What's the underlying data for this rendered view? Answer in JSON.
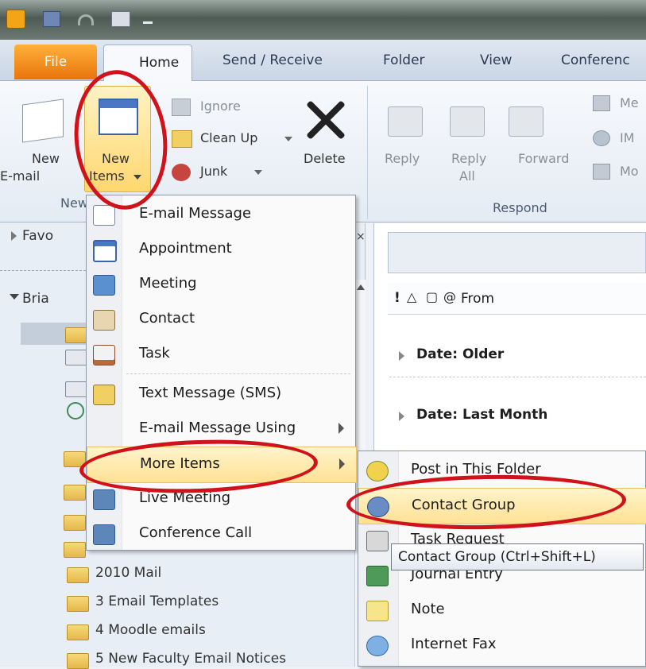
{
  "quick_access": {
    "app_icon": "outlook-icon",
    "save_icon": "save-icon",
    "undo_icon": "undo-icon",
    "print_icon": "print-icon"
  },
  "tabs": [
    "File",
    "Home",
    "Send / Receive",
    "Folder",
    "View",
    "Conferenc"
  ],
  "ribbon": {
    "new_email": {
      "line1": "New",
      "line2": "E-mail"
    },
    "new_items": {
      "line1": "New",
      "line2": "Items"
    },
    "group_new_label": "New",
    "ignore": "Ignore",
    "clean_up": "Clean Up",
    "junk": "Junk",
    "delete": "Delete",
    "reply": "Reply",
    "reply_all": {
      "line1": "Reply",
      "line2": "All"
    },
    "forward": "Forward",
    "respond_label": "Respond",
    "meeting_partial": "Me",
    "im_partial": "IM",
    "more_partial": "Mo"
  },
  "nav": {
    "favorites": "Favo",
    "account": "Bria",
    "folders": [
      "2010 Mail",
      "3 Email Templates",
      "4 Moodle emails",
      "5 New Faculty Email Notices"
    ]
  },
  "mail_list": {
    "columns_header": "From",
    "groups": [
      "Date: Older",
      "Date: Last Month"
    ]
  },
  "new_items_menu": [
    {
      "label": "E-mail Message",
      "icon": "email-message-icon"
    },
    {
      "label": "Appointment",
      "icon": "appointment-icon"
    },
    {
      "label": "Meeting",
      "icon": "meeting-icon"
    },
    {
      "label": "Contact",
      "icon": "contact-icon"
    },
    {
      "label": "Task",
      "icon": "task-icon"
    },
    {
      "label": "Text Message (SMS)",
      "icon": "text-message-icon"
    },
    {
      "label": "E-mail Message Using",
      "icon": ""
    },
    {
      "label": "More Items",
      "icon": ""
    },
    {
      "label": "Live Meeting",
      "icon": "live-meeting-icon"
    },
    {
      "label": "Conference Call",
      "icon": "conference-call-icon"
    }
  ],
  "more_items_submenu": [
    {
      "label": "Post in This Folder",
      "icon": "post-icon"
    },
    {
      "label": "Contact Group",
      "icon": "contact-group-icon"
    },
    {
      "label": "Task Request",
      "icon": "task-request-icon"
    },
    {
      "label": "Journal Entry",
      "icon": "journal-entry-icon"
    },
    {
      "label": "Note",
      "icon": "note-icon"
    },
    {
      "label": "Internet Fax",
      "icon": "internet-fax-icon"
    }
  ],
  "tooltip": "Contact Group (Ctrl+Shift+L)",
  "colors": {
    "file_tab": "#f08a18",
    "highlight": "#ffe193",
    "annotation": "#d0121b"
  }
}
